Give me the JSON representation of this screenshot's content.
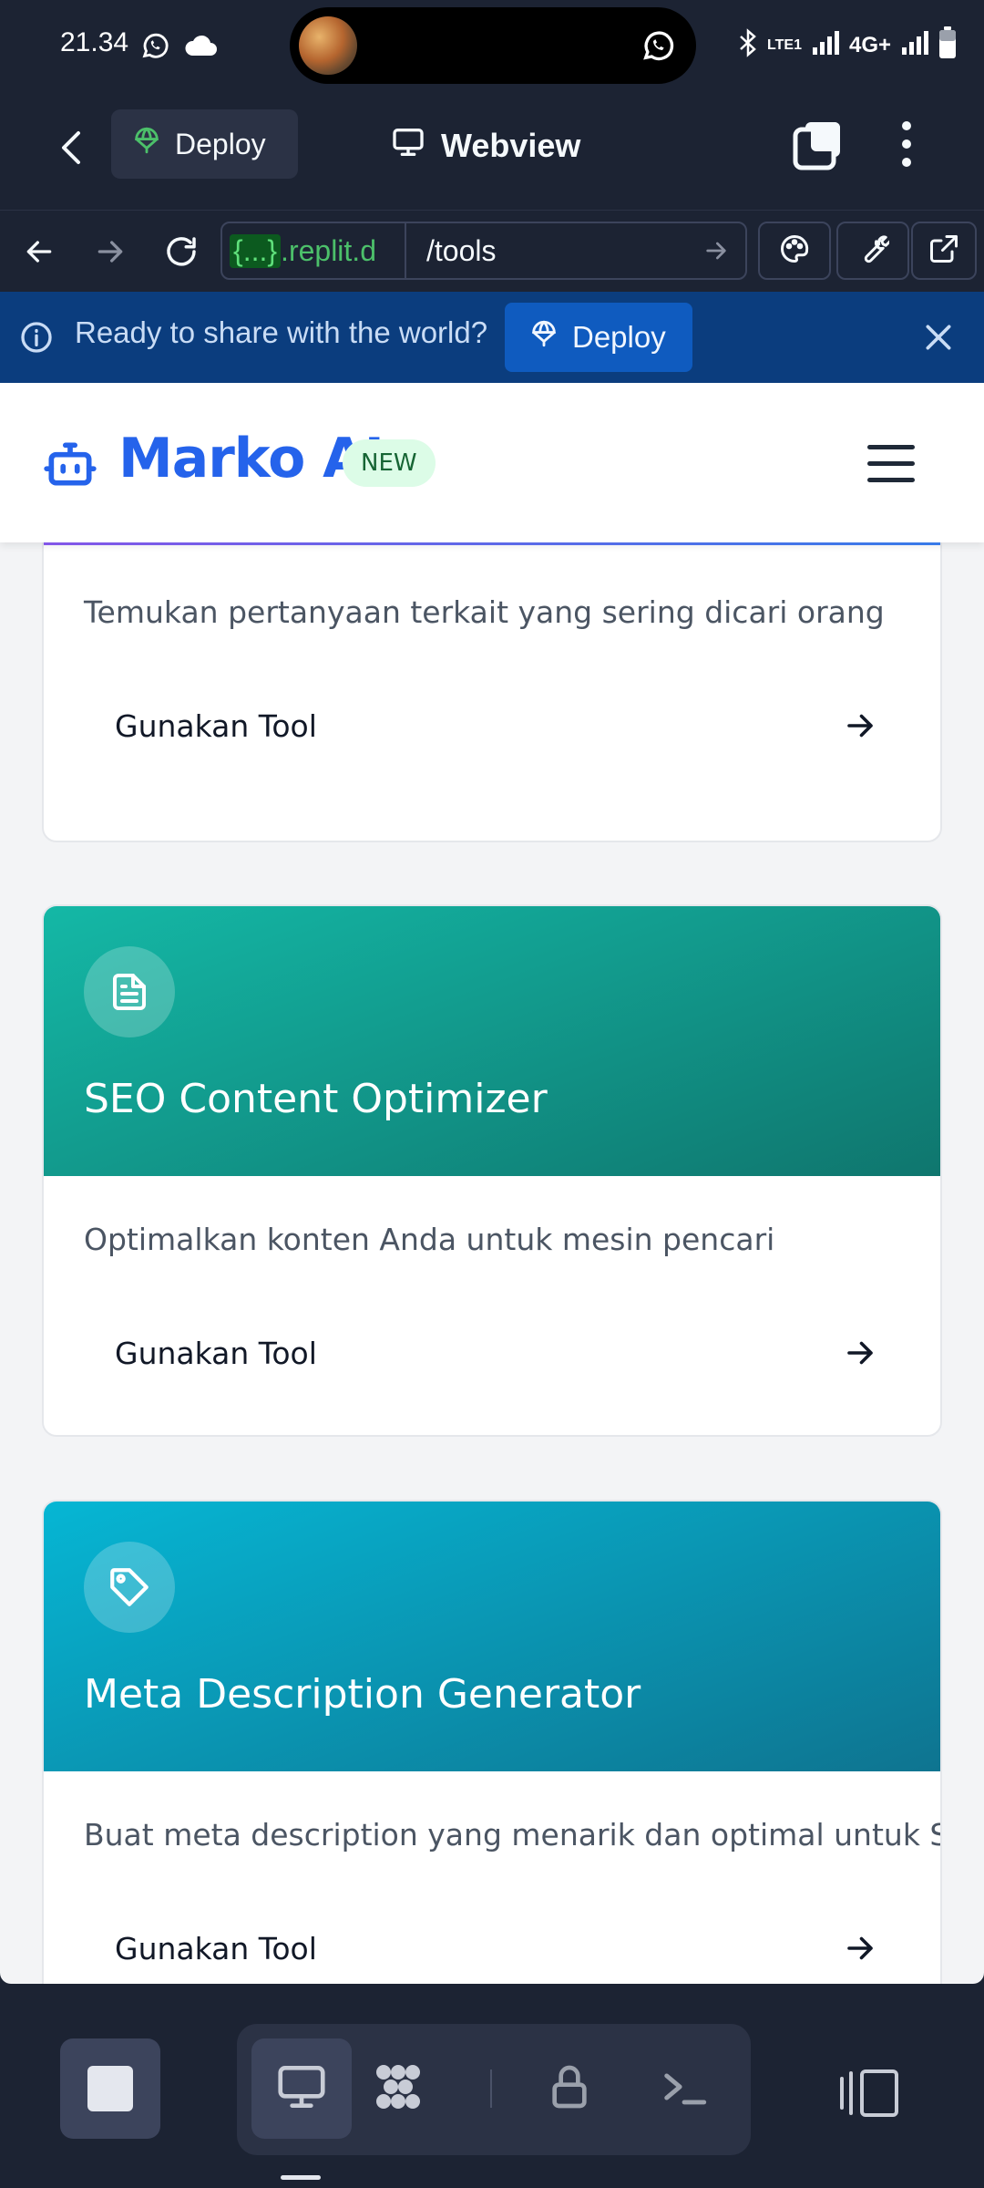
{
  "status_bar": {
    "time": "21.34",
    "network": "4G+",
    "volte": "LTE1"
  },
  "header": {
    "deploy_label": "Deploy",
    "title": "Webview"
  },
  "url_bar": {
    "host_highlight": "{...}",
    "host_rest": ".replit.d",
    "path": "/tools"
  },
  "banner": {
    "text": "Ready to share with the world?",
    "deploy_label": "Deploy"
  },
  "app": {
    "brand": "Marko AI",
    "badge": "NEW"
  },
  "cards": [
    {
      "title": "",
      "description": "Temukan pertanyaan terkait yang sering dicari orang",
      "button_label": "Gunakan Tool",
      "icon": "",
      "gradient": [
        "#8b5cf6",
        "#3b82f6"
      ]
    },
    {
      "title": "SEO Content Optimizer",
      "description": "Optimalkan konten Anda untuk mesin pencari",
      "button_label": "Gunakan Tool",
      "icon": "document-icon",
      "gradient": [
        "#14b8a6",
        "#0f766e"
      ]
    },
    {
      "title": "Meta Description Generator",
      "description": "Buat meta description yang menarik dan optimal untuk SEO",
      "button_label": "Gunakan Tool",
      "icon": "tag-icon",
      "gradient": [
        "#06b6d4",
        "#0e7490"
      ]
    }
  ],
  "colors": {
    "brand_blue": "#2563eb",
    "replit_bg": "#1c2333",
    "banner_bg": "#0b3d7e"
  }
}
